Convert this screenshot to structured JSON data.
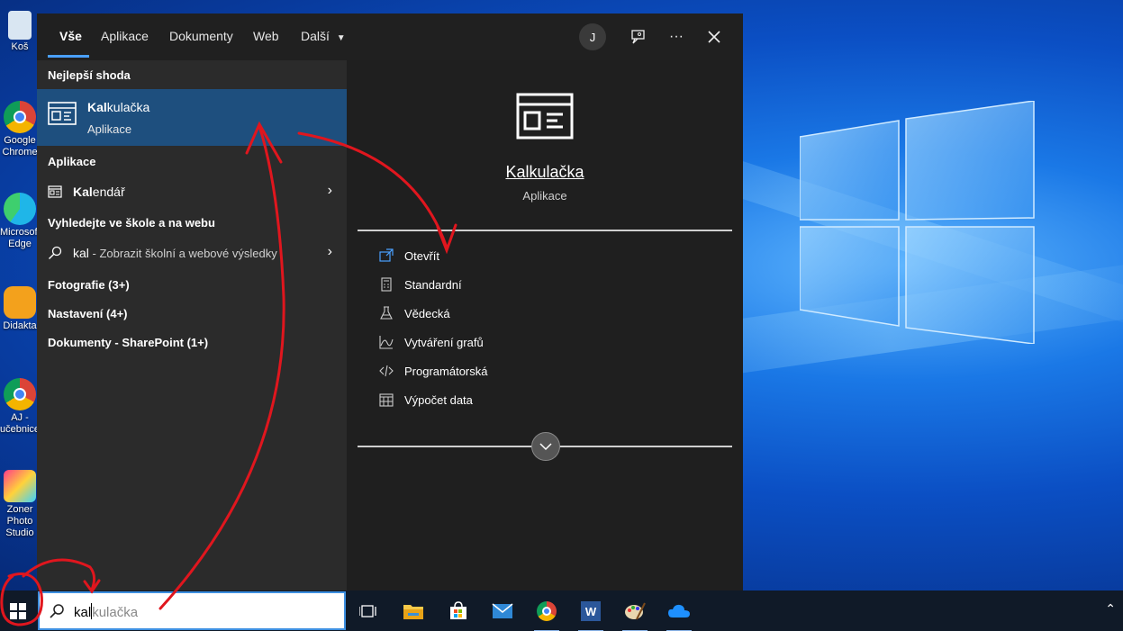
{
  "desktop": {
    "icons": [
      {
        "label": "Koš",
        "icon": "recycle-bin-icon"
      },
      {
        "label": "Google Chrome",
        "icon": "chrome-icon"
      },
      {
        "label": "Microsoft Edge",
        "icon": "edge-icon"
      },
      {
        "label": "Didakta",
        "icon": "owl-icon"
      },
      {
        "label": "AJ - učebnice",
        "icon": "chrome-icon"
      },
      {
        "label": "Zoner Photo Studio",
        "icon": "zoner-icon"
      }
    ]
  },
  "search_panel": {
    "tabs": [
      {
        "label": "Vše",
        "active": true
      },
      {
        "label": "Aplikace"
      },
      {
        "label": "Dokumenty"
      },
      {
        "label": "Web"
      },
      {
        "label": "Další"
      }
    ],
    "avatar_initial": "J",
    "more_label": "···",
    "best_match": {
      "section_label": "Nejlepší shoda",
      "name_bold": "Kal",
      "name_rest": "kulačka",
      "type": "Aplikace"
    },
    "apps_section": {
      "label": "Aplikace",
      "items": [
        {
          "name_bold": "Kal",
          "name_rest": "endář"
        }
      ]
    },
    "web_section": {
      "label": "Vyhledejte ve škole a na webu",
      "query": "kal",
      "hint": " - Zobrazit školní a webové výsledky"
    },
    "categories": [
      "Fotografie (3+)",
      "Nastavení (4+)",
      "Dokumenty - SharePoint (1+)"
    ],
    "preview": {
      "app_name": "Kalkulačka",
      "app_type": "Aplikace",
      "actions": [
        {
          "label": "Otevřít",
          "icon": "open-icon"
        },
        {
          "label": "Standardní",
          "icon": "calculator-icon"
        },
        {
          "label": "Vědecká",
          "icon": "flask-icon"
        },
        {
          "label": "Vytváření grafů",
          "icon": "graph-icon"
        },
        {
          "label": "Programátorská",
          "icon": "code-icon"
        },
        {
          "label": "Výpočet data",
          "icon": "calendar-icon"
        }
      ]
    }
  },
  "taskbar": {
    "search_typed": "kal",
    "search_suggestion": "kulačka",
    "apps": [
      "task-view-icon",
      "file-explorer-icon",
      "store-icon",
      "mail-icon",
      "chrome-icon",
      "word-icon",
      "paint-icon",
      "onedrive-icon"
    ],
    "tray_chevron": "⌃"
  },
  "colors": {
    "accent": "#4aa0ff",
    "best_match_bg": "#1e4f7e",
    "annotation": "#e0161e"
  }
}
